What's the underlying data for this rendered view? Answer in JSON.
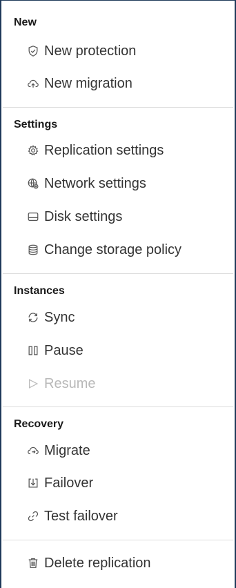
{
  "sections": {
    "new": {
      "title": "New",
      "items": [
        "New protection",
        "New migration"
      ]
    },
    "settings": {
      "title": "Settings",
      "items": [
        "Replication settings",
        "Network settings",
        "Disk settings",
        "Change storage policy"
      ]
    },
    "instances": {
      "title": "Instances",
      "items": [
        "Sync",
        "Pause",
        "Resume"
      ]
    },
    "recovery": {
      "title": "Recovery",
      "items": [
        "Migrate",
        "Failover",
        "Test failover"
      ]
    },
    "other": {
      "items": [
        "Delete replication"
      ]
    }
  },
  "icons": {
    "new_protection": "shield-check-icon",
    "new_migration": "cloud-upload-icon",
    "replication_settings": "gear-icon",
    "network_settings": "network-globe-icon",
    "disk_settings": "disk-icon",
    "change_storage_policy": "database-icon",
    "sync": "sync-icon",
    "pause": "pause-icon",
    "resume": "play-icon",
    "migrate": "cloud-migrate-icon",
    "failover": "failover-icon",
    "test_failover": "link-icon",
    "delete_replication": "trash-icon"
  },
  "colors": {
    "text": "#333333",
    "disabled": "#b8b8b8",
    "heading": "#1a1a1a",
    "divider": "#dcdcdc",
    "frame": "#1f3a5a"
  }
}
